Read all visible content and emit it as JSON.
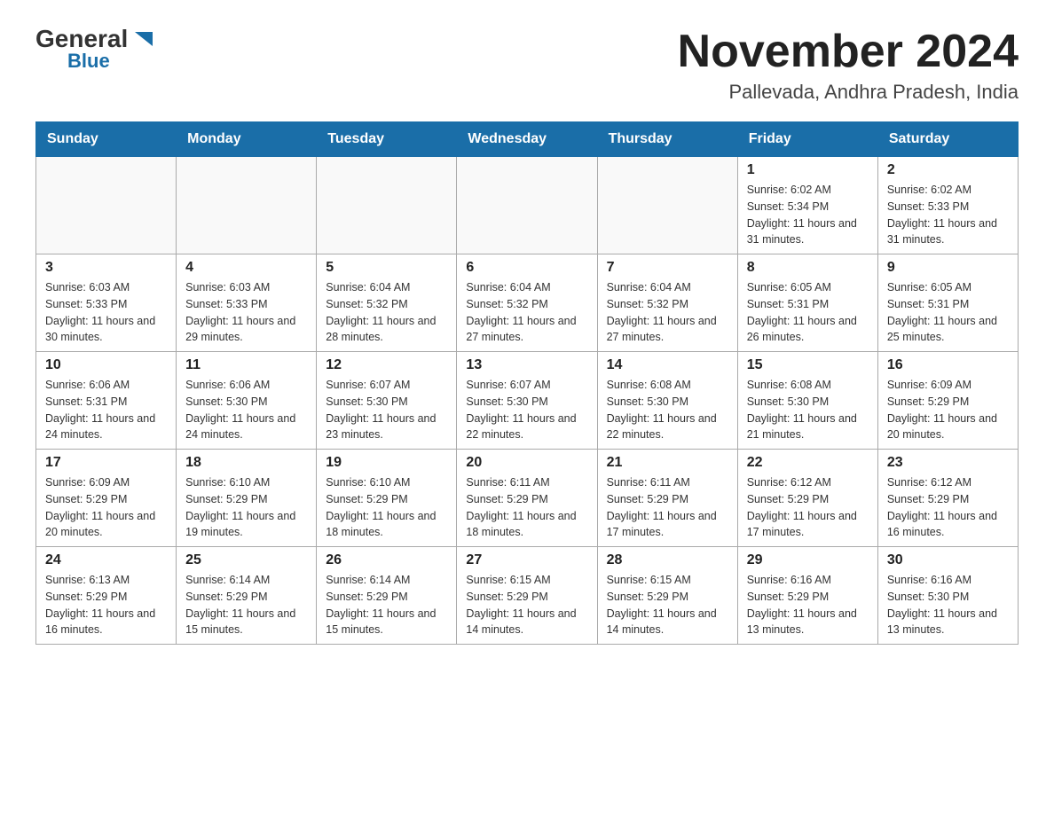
{
  "logo": {
    "general": "General",
    "blue": "Blue"
  },
  "title": "November 2024",
  "location": "Pallevada, Andhra Pradesh, India",
  "weekdays": [
    "Sunday",
    "Monday",
    "Tuesday",
    "Wednesday",
    "Thursday",
    "Friday",
    "Saturday"
  ],
  "weeks": [
    [
      {
        "day": "",
        "info": ""
      },
      {
        "day": "",
        "info": ""
      },
      {
        "day": "",
        "info": ""
      },
      {
        "day": "",
        "info": ""
      },
      {
        "day": "",
        "info": ""
      },
      {
        "day": "1",
        "info": "Sunrise: 6:02 AM\nSunset: 5:34 PM\nDaylight: 11 hours and 31 minutes."
      },
      {
        "day": "2",
        "info": "Sunrise: 6:02 AM\nSunset: 5:33 PM\nDaylight: 11 hours and 31 minutes."
      }
    ],
    [
      {
        "day": "3",
        "info": "Sunrise: 6:03 AM\nSunset: 5:33 PM\nDaylight: 11 hours and 30 minutes."
      },
      {
        "day": "4",
        "info": "Sunrise: 6:03 AM\nSunset: 5:33 PM\nDaylight: 11 hours and 29 minutes."
      },
      {
        "day": "5",
        "info": "Sunrise: 6:04 AM\nSunset: 5:32 PM\nDaylight: 11 hours and 28 minutes."
      },
      {
        "day": "6",
        "info": "Sunrise: 6:04 AM\nSunset: 5:32 PM\nDaylight: 11 hours and 27 minutes."
      },
      {
        "day": "7",
        "info": "Sunrise: 6:04 AM\nSunset: 5:32 PM\nDaylight: 11 hours and 27 minutes."
      },
      {
        "day": "8",
        "info": "Sunrise: 6:05 AM\nSunset: 5:31 PM\nDaylight: 11 hours and 26 minutes."
      },
      {
        "day": "9",
        "info": "Sunrise: 6:05 AM\nSunset: 5:31 PM\nDaylight: 11 hours and 25 minutes."
      }
    ],
    [
      {
        "day": "10",
        "info": "Sunrise: 6:06 AM\nSunset: 5:31 PM\nDaylight: 11 hours and 24 minutes."
      },
      {
        "day": "11",
        "info": "Sunrise: 6:06 AM\nSunset: 5:30 PM\nDaylight: 11 hours and 24 minutes."
      },
      {
        "day": "12",
        "info": "Sunrise: 6:07 AM\nSunset: 5:30 PM\nDaylight: 11 hours and 23 minutes."
      },
      {
        "day": "13",
        "info": "Sunrise: 6:07 AM\nSunset: 5:30 PM\nDaylight: 11 hours and 22 minutes."
      },
      {
        "day": "14",
        "info": "Sunrise: 6:08 AM\nSunset: 5:30 PM\nDaylight: 11 hours and 22 minutes."
      },
      {
        "day": "15",
        "info": "Sunrise: 6:08 AM\nSunset: 5:30 PM\nDaylight: 11 hours and 21 minutes."
      },
      {
        "day": "16",
        "info": "Sunrise: 6:09 AM\nSunset: 5:29 PM\nDaylight: 11 hours and 20 minutes."
      }
    ],
    [
      {
        "day": "17",
        "info": "Sunrise: 6:09 AM\nSunset: 5:29 PM\nDaylight: 11 hours and 20 minutes."
      },
      {
        "day": "18",
        "info": "Sunrise: 6:10 AM\nSunset: 5:29 PM\nDaylight: 11 hours and 19 minutes."
      },
      {
        "day": "19",
        "info": "Sunrise: 6:10 AM\nSunset: 5:29 PM\nDaylight: 11 hours and 18 minutes."
      },
      {
        "day": "20",
        "info": "Sunrise: 6:11 AM\nSunset: 5:29 PM\nDaylight: 11 hours and 18 minutes."
      },
      {
        "day": "21",
        "info": "Sunrise: 6:11 AM\nSunset: 5:29 PM\nDaylight: 11 hours and 17 minutes."
      },
      {
        "day": "22",
        "info": "Sunrise: 6:12 AM\nSunset: 5:29 PM\nDaylight: 11 hours and 17 minutes."
      },
      {
        "day": "23",
        "info": "Sunrise: 6:12 AM\nSunset: 5:29 PM\nDaylight: 11 hours and 16 minutes."
      }
    ],
    [
      {
        "day": "24",
        "info": "Sunrise: 6:13 AM\nSunset: 5:29 PM\nDaylight: 11 hours and 16 minutes."
      },
      {
        "day": "25",
        "info": "Sunrise: 6:14 AM\nSunset: 5:29 PM\nDaylight: 11 hours and 15 minutes."
      },
      {
        "day": "26",
        "info": "Sunrise: 6:14 AM\nSunset: 5:29 PM\nDaylight: 11 hours and 15 minutes."
      },
      {
        "day": "27",
        "info": "Sunrise: 6:15 AM\nSunset: 5:29 PM\nDaylight: 11 hours and 14 minutes."
      },
      {
        "day": "28",
        "info": "Sunrise: 6:15 AM\nSunset: 5:29 PM\nDaylight: 11 hours and 14 minutes."
      },
      {
        "day": "29",
        "info": "Sunrise: 6:16 AM\nSunset: 5:29 PM\nDaylight: 11 hours and 13 minutes."
      },
      {
        "day": "30",
        "info": "Sunrise: 6:16 AM\nSunset: 5:30 PM\nDaylight: 11 hours and 13 minutes."
      }
    ]
  ]
}
